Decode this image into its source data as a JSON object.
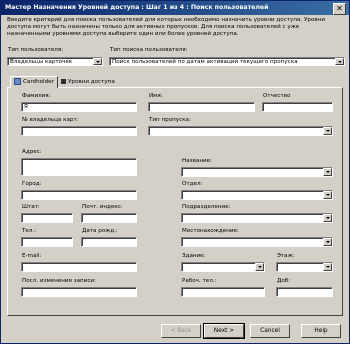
{
  "window": {
    "title": "Мастер Назначения Уровней доступа : Шаг 1 из 4 : Поиск пользователей",
    "close_glyph": "✕"
  },
  "description": "Введите критерий для поиска пользователей для которых необходимо назначить уровни доступа. Уровни доступа могут быть назначены только для активных пропусков. Для поиска пользователей с уже назначенными уровнями доступа выберите один или более уровней доступа.",
  "search": {
    "user_type_label": "Тип пользователя:",
    "user_type_value": "Владельцы карточек",
    "search_type_label": "Тип поиска пользователя:",
    "search_type_value": "Поиск пользователей по датам активации текущего пропуска"
  },
  "tabs": [
    {
      "label": "Cardholder"
    },
    {
      "label": "Уровни доступа"
    }
  ],
  "form": {
    "last_name": {
      "label": "Фамилия:",
      "value": "Я"
    },
    "first_name": {
      "label": "Имя:",
      "value": ""
    },
    "middle_name": {
      "label": "Отчество",
      "value": ""
    },
    "card_number": {
      "label": "№ владельца карт:",
      "value": ""
    },
    "pass_type": {
      "label": "Тип пропуска:",
      "value": ""
    },
    "address": {
      "label": "Адрес:",
      "value": ""
    },
    "title": {
      "label": "Название:",
      "value": ""
    },
    "city": {
      "label": "Город:",
      "value": ""
    },
    "department": {
      "label": "Отдел:",
      "value": ""
    },
    "state": {
      "label": "Штат:",
      "value": ""
    },
    "zip": {
      "label": "Почт. индекс:",
      "value": ""
    },
    "division": {
      "label": "Подразделение:",
      "value": ""
    },
    "phone": {
      "label": "Тел.:",
      "value": ""
    },
    "birthdate": {
      "label": "Дата рожд.:",
      "value": ""
    },
    "location": {
      "label": "Местонахождение:",
      "value": ""
    },
    "email": {
      "label": "E-mail:",
      "value": ""
    },
    "building": {
      "label": "Здание:",
      "value": ""
    },
    "floor": {
      "label": "Этаж:",
      "value": ""
    },
    "last_change": {
      "label": "Посл. изменения записи:",
      "value": ""
    },
    "work_phone": {
      "label": "Рабоч. тел.:",
      "value": ""
    },
    "ext": {
      "label": "Доб:",
      "value": ""
    }
  },
  "buttons": {
    "back": "< Back",
    "next": "Next >",
    "cancel": "Cancel",
    "help": "Help"
  }
}
